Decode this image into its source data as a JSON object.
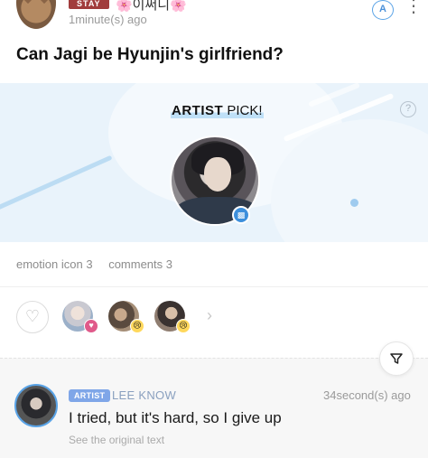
{
  "header": {
    "badge": "STAY",
    "nickname": "🌸이써니🌸",
    "time": "1minute(s) ago",
    "translate_icon": "A",
    "more_icon": "⋮"
  },
  "post": {
    "title": "Can Jagi be Hyunjin's girlfriend?"
  },
  "banner": {
    "pick_bold": "ARTIST",
    "pick_rest": " PICK!",
    "help_icon": "?"
  },
  "stats": {
    "emotion": "emotion icon 3",
    "comments": "comments 3"
  },
  "reactions": {
    "heart_icon": "♡",
    "chevron_icon": "›",
    "emotions": [
      "♥",
      "😢",
      "😢"
    ]
  },
  "comment": {
    "filter_icon": "⏷",
    "tag": "ARTIST",
    "author": "LEE KNOW",
    "time": "34second(s) ago",
    "text": "I tried, but it's hard, so I give up",
    "see_original": "See the original text"
  },
  "colors": {
    "accent_blue": "#3d8fdc",
    "stay_badge": "#a13c3c",
    "banner_bg": "#e9f3fb"
  }
}
